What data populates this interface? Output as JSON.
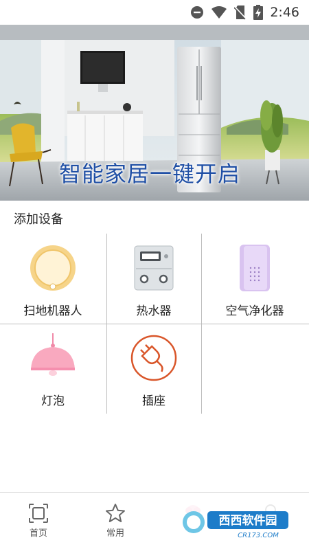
{
  "status_bar": {
    "time": "2:46",
    "icons": [
      "do-not-disturb-icon",
      "wifi-icon",
      "no-sim-icon",
      "battery-charging-icon"
    ]
  },
  "banner": {
    "headline": "智能家居一键开启"
  },
  "section": {
    "title": "添加设备"
  },
  "devices": [
    {
      "label": "扫地机器人",
      "icon": "robot-vacuum-icon"
    },
    {
      "label": "热水器",
      "icon": "water-heater-icon"
    },
    {
      "label": "空气净化器",
      "icon": "air-purifier-icon"
    },
    {
      "label": "灯泡",
      "icon": "lamp-icon"
    },
    {
      "label": "插座",
      "icon": "plug-icon"
    }
  ],
  "nav": {
    "items": [
      {
        "label": "首页",
        "icon": "home-frame-icon"
      },
      {
        "label": "常用",
        "icon": "star-icon"
      },
      {
        "label": "",
        "icon": "scene-icon"
      },
      {
        "label": "",
        "icon": "profile-icon"
      }
    ]
  },
  "watermark": {
    "brand": "西西软件园",
    "domain": "CR173.COM"
  },
  "colors": {
    "accent_orange": "#d9562a",
    "headline_blue": "#1f4fa5",
    "grid_line": "#bdbdbd"
  }
}
